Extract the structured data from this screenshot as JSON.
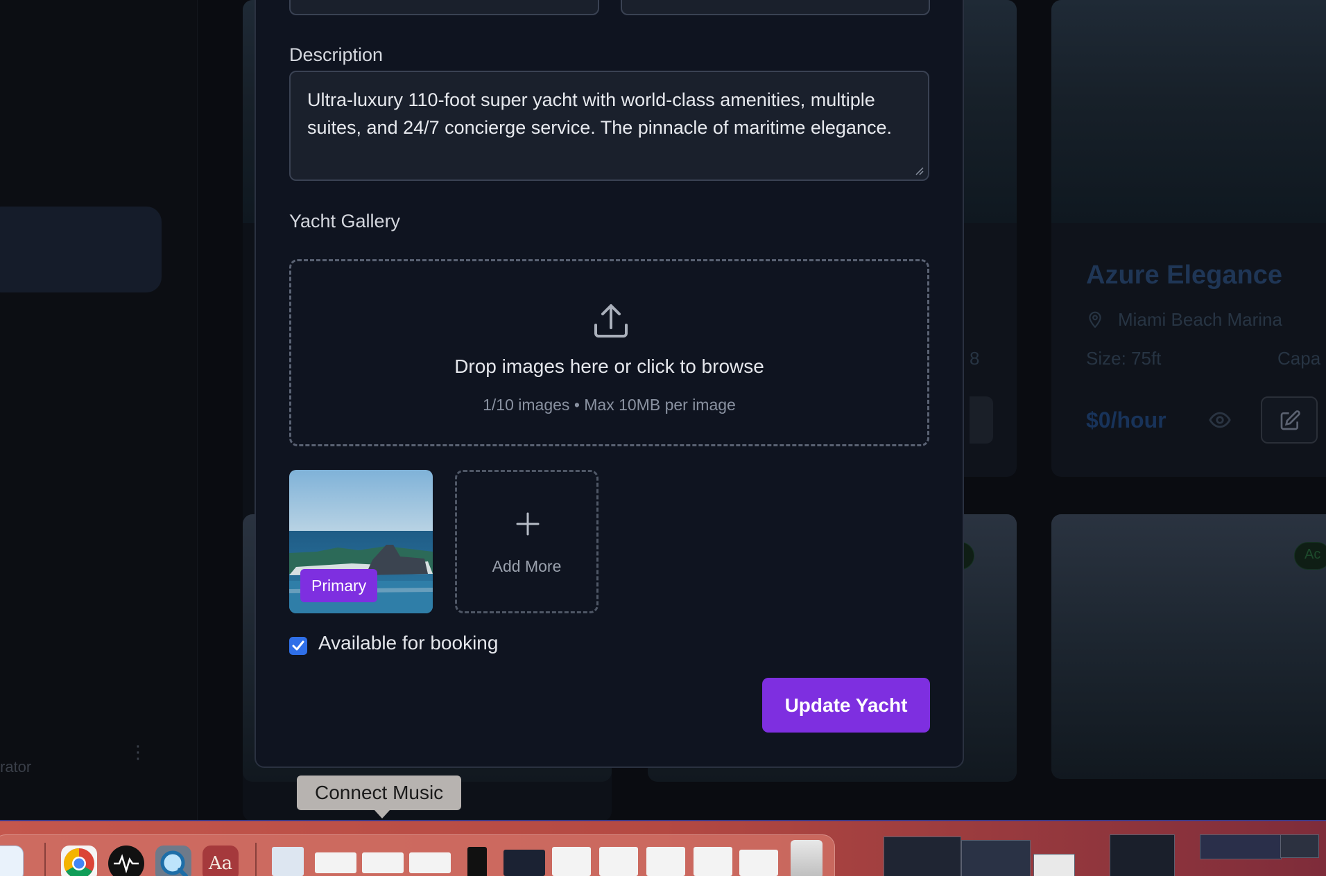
{
  "background": {
    "sidebar": {
      "role_text": "rator"
    },
    "cards": [
      {
        "title": "Azure Elegance",
        "location": "Miami Beach Marina",
        "size": "Size: 75ft",
        "capacity_partial": "Capa",
        "price": "$0/hour"
      }
    ],
    "partial_capacity_value": "8",
    "badge_partial_1": "e",
    "badge_partial_2": "Ac"
  },
  "modal": {
    "description_label": "Description",
    "description_value": "Ultra-luxury 110-foot super yacht with world-class amenities, multiple suites, and 24/7 concierge service. The pinnacle of maritime elegance.",
    "gallery_label": "Yacht Gallery",
    "dropzone": {
      "title": "Drop images here or click to browse",
      "subtitle": "1/10 images • Max 10MB per image"
    },
    "images": [
      {
        "badge": "Primary"
      }
    ],
    "add_more_label": "Add More",
    "available_label": "Available for booking",
    "available_checked": true,
    "submit_label": "Update Yacht",
    "accent_color": "#7e2fe0",
    "checkbox_color": "#2f6fe8"
  },
  "tooltip": {
    "text": "Connect Music"
  },
  "dock": {
    "icons": [
      "finder-icon",
      "chrome-icon",
      "music-app-icon",
      "quicktime-icon",
      "dictionary-icon",
      "trash-icon"
    ],
    "dictionary_glyph": "Aa"
  }
}
